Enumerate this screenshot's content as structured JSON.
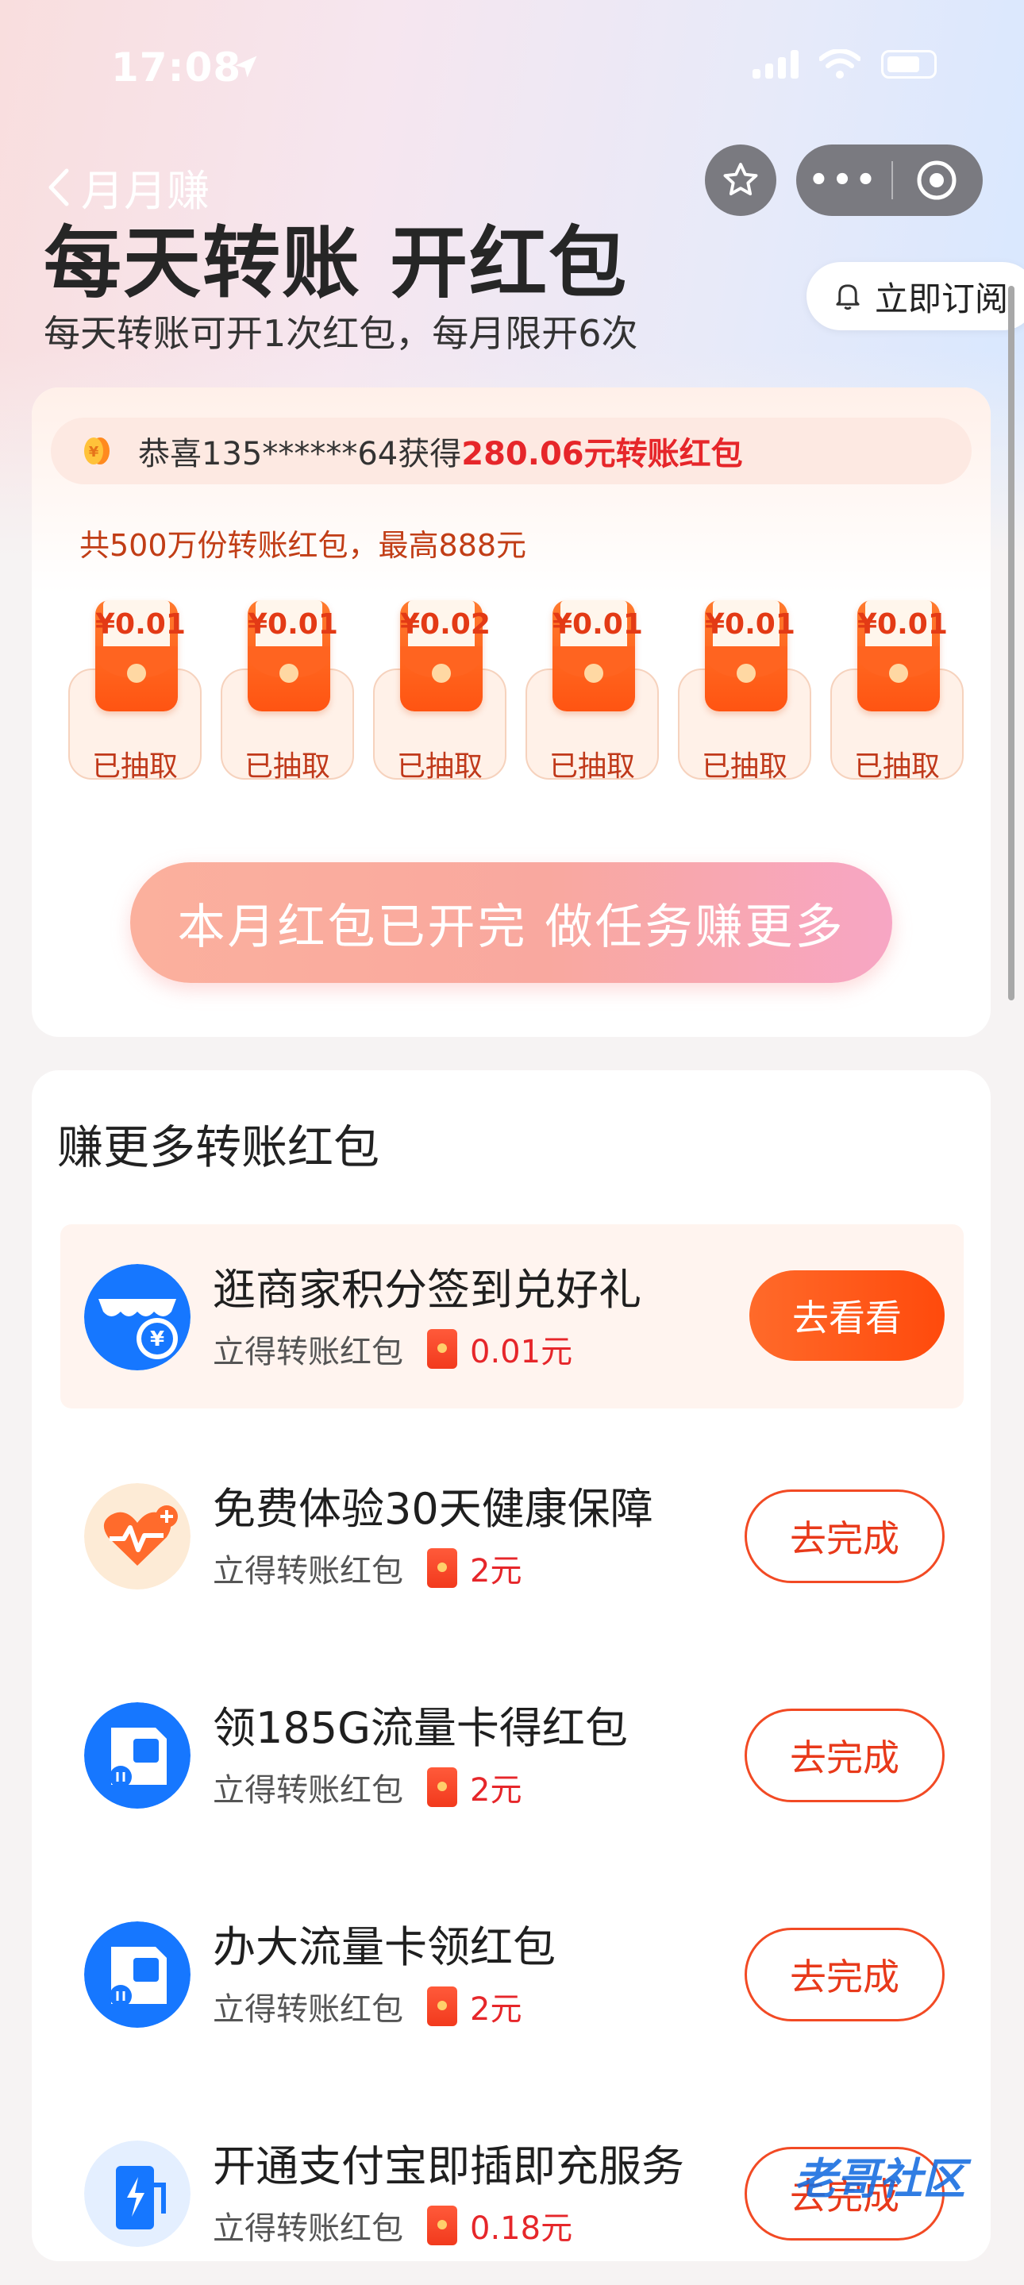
{
  "status_bar": {
    "time": "17:08"
  },
  "nav": {
    "back_label": "月月赚",
    "subscribe_label": "立即订阅"
  },
  "header": {
    "title": "每天转账 开红包",
    "subtitle": "每天转账可开1次红包，每月限开6次"
  },
  "ticker": {
    "prefix": "恭喜135******64获得",
    "highlight": "280.06元转账红包"
  },
  "pool_text": "共500万份转账红包，最高888元",
  "envelopes": [
    {
      "amount": "¥0.01",
      "status": "已抽取"
    },
    {
      "amount": "¥0.01",
      "status": "已抽取"
    },
    {
      "amount": "¥0.02",
      "status": "已抽取"
    },
    {
      "amount": "¥0.01",
      "status": "已抽取"
    },
    {
      "amount": "¥0.01",
      "status": "已抽取"
    },
    {
      "amount": "¥0.01",
      "status": "已抽取"
    }
  ],
  "main_button": "本月红包已开完 做任务赚更多",
  "tasks_section": {
    "title": "赚更多转账红包",
    "tasks": [
      {
        "name": "逛商家积分签到兑好礼",
        "reward_label": "立得转账红包",
        "reward": "0.01元",
        "button": "去看看"
      },
      {
        "name": "免费体验30天健康保障",
        "reward_label": "立得转账红包",
        "reward": "2元",
        "button": "去完成"
      },
      {
        "name": "领185G流量卡得红包",
        "reward_label": "立得转账红包",
        "reward": "2元",
        "button": "去完成"
      },
      {
        "name": "办大流量卡领红包",
        "reward_label": "立得转账红包",
        "reward": "2元",
        "button": "去完成"
      },
      {
        "name": "开通支付宝即插即充服务",
        "reward_label": "立得转账红包",
        "reward": "0.18元",
        "button": "去完成"
      }
    ]
  },
  "watermark": "老哥社区",
  "colors": {
    "accent": "#ff4a0c",
    "highlight_red": "#e6262a",
    "icon_blue": "#1677ff"
  }
}
